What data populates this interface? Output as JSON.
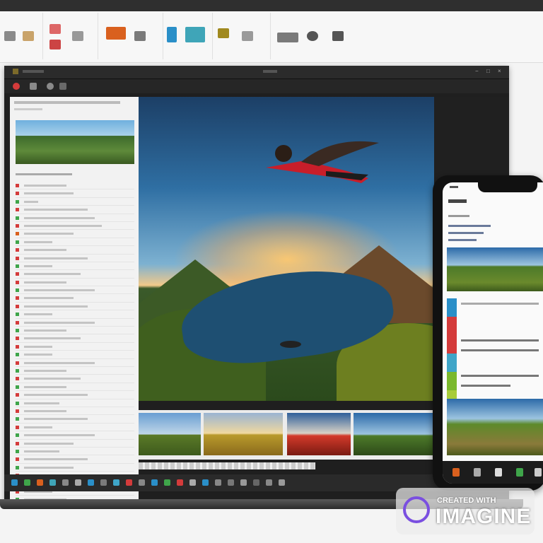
{
  "watermark": {
    "line1": "CREATED WITH",
    "line2": "IMAGINE"
  },
  "colors": {
    "ribbon_bg": "#f7f7f7",
    "window_bg": "#1f1f1f",
    "sidebar_bg": "#f2f2f2",
    "phone_bg": "#111111",
    "watermark_ring": "#7a4fe0"
  },
  "icons": {
    "close": "close-icon",
    "minimize": "minimize-icon",
    "maximize": "maximize-icon"
  }
}
